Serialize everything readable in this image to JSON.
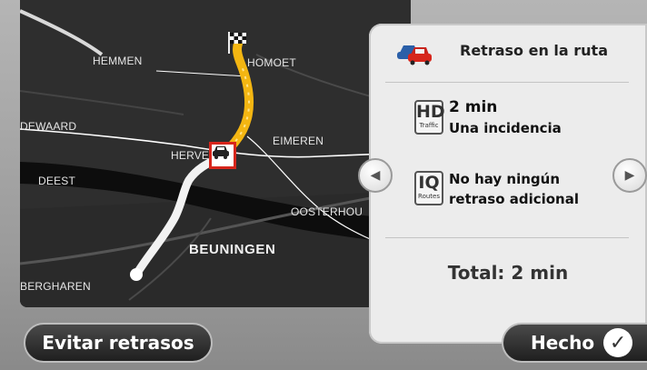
{
  "map": {
    "places": {
      "hemmen": "HEMMEN",
      "homoet": "HOMOET",
      "dewaard": "DEWAARD",
      "herveld": "HERVE",
      "eimeren": "EIMEREN",
      "deest": "DEEST",
      "oosterhout": "OOSTERHOU",
      "beuningen": "BEUNINGEN",
      "berghaaren": "BERGHAREN"
    }
  },
  "panel": {
    "title": "Retraso en la ruta",
    "hd": {
      "badge": "HD",
      "badge_sub": "Traffic",
      "line1": "2 min",
      "line2": "Una incidencia"
    },
    "iq": {
      "badge": "IQ",
      "badge_sub": "Routes",
      "line1": "No hay ningún",
      "line2": "retraso adicional"
    },
    "total": "Total:  2 min"
  },
  "buttons": {
    "avoid": "Evitar retrasos",
    "done": "Hecho"
  },
  "icons": {
    "car": "car-traffic-icon",
    "prev": "chevron-left-icon",
    "next": "chevron-right-icon",
    "check": "checkmark-icon",
    "flag": "checkered-flag-icon",
    "incident": "traffic-incident-icon"
  }
}
